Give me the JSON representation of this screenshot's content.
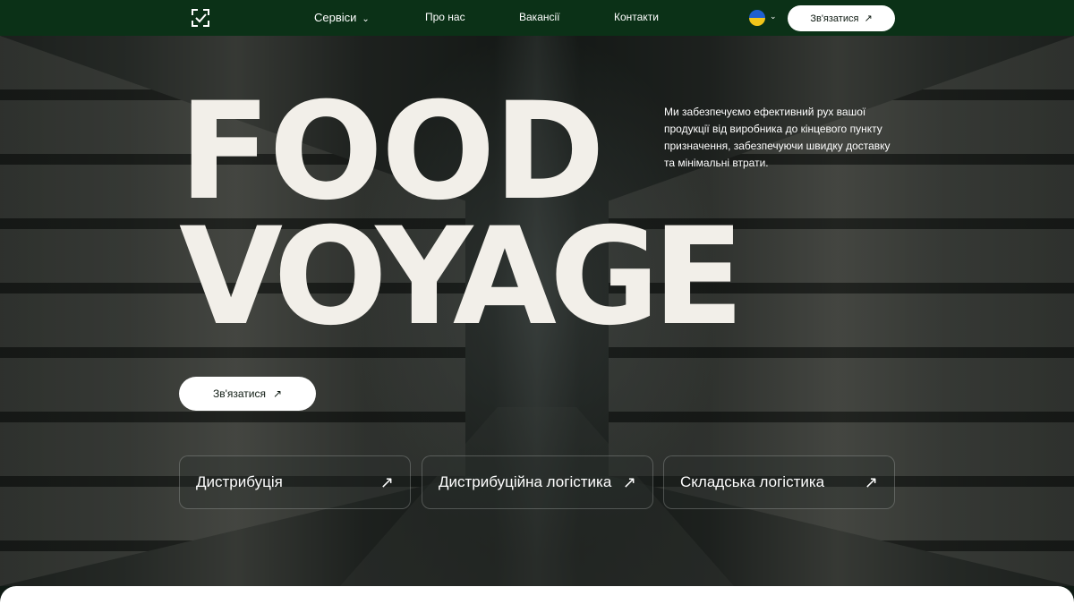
{
  "nav": {
    "services": "Сервіси",
    "about": "Про нас",
    "vacancies": "Вакансії",
    "contacts": "Контакти",
    "cta": "Зв'язатися"
  },
  "hero": {
    "title_line1": "FOOD",
    "title_line2": "VOYAGE",
    "tagline": "Ми забезпечуємо ефективний рух вашої продукції від виробника до кінцевого пункту призначення, забезпечуючи швидку доставку та мінімальні втрати.",
    "cta": "Зв'язатися"
  },
  "cards": [
    {
      "label": "Дистрибуція"
    },
    {
      "label": "Дистрибуційна логістика"
    },
    {
      "label": "Складська логістика"
    }
  ],
  "icons": {
    "arrow": "↗",
    "chevron": "⌄"
  },
  "colors": {
    "nav_bg": "#0b3117",
    "title": "#f2efe9",
    "flag_blue": "#1f5fd0",
    "flag_yellow": "#f2c51a"
  }
}
